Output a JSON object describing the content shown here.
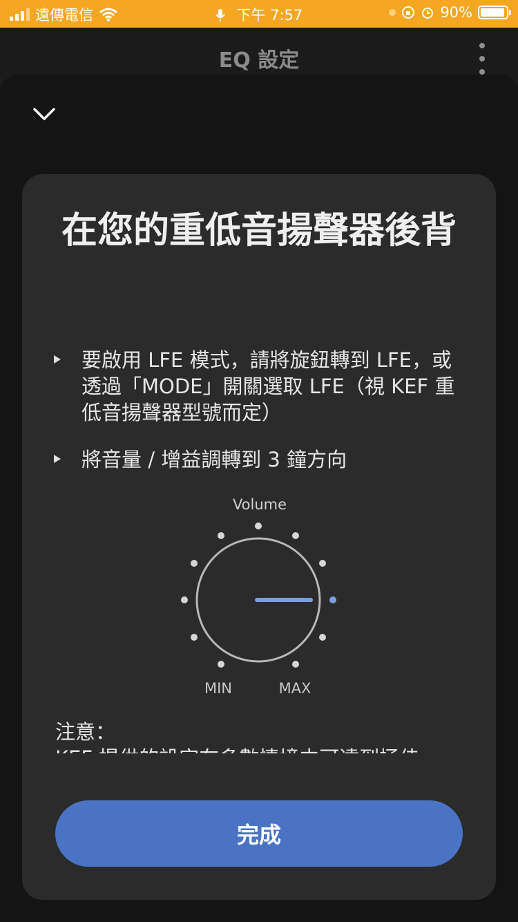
{
  "status_bar": {
    "carrier": "遠傳電信",
    "time": "下午 7:57",
    "battery": "90%",
    "battery_level": 0.9
  },
  "header": {
    "title": "EQ 設定"
  },
  "card": {
    "title": "在您的重低音揚聲器後背",
    "bullets": [
      "要啟用 LFE 模式，請將旋鈕轉到 LFE，或透過「MODE」開關選取 LFE（視 KEF 重低音揚聲器型號而定）",
      "將音量 / 增益調轉到 3 鐘方向"
    ],
    "knob": {
      "label": "Volume",
      "min_label": "MIN",
      "max_label": "MAX",
      "position": "3 o'clock",
      "accent_color": "#7a9fe0"
    },
    "note_title": "注意：",
    "note_text": "KEF 提供的設定在多數情境中可達到極佳"
  },
  "done_button": {
    "label": "完成",
    "color": "#4a74c3"
  }
}
